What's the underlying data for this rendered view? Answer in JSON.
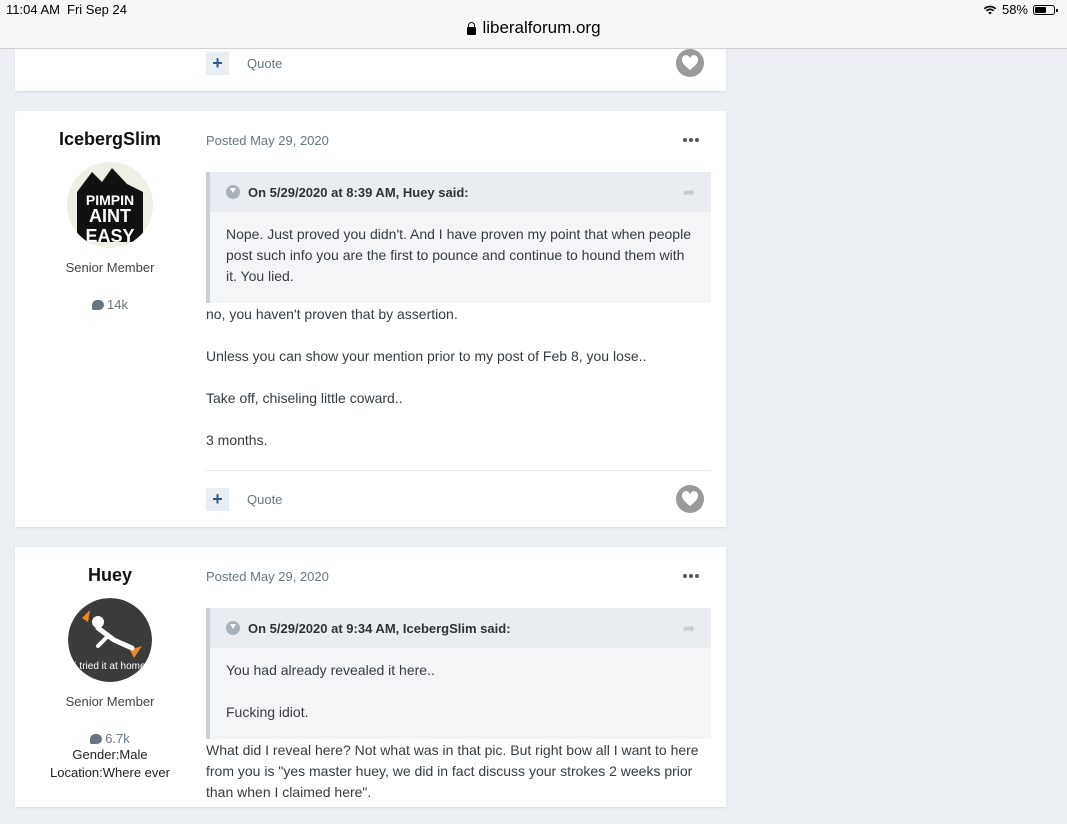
{
  "status": {
    "time": "11:04 AM",
    "date": "Fri Sep 24",
    "battery": "58%",
    "url": "liberalforum.org"
  },
  "actions": {
    "quote_label": "Quote",
    "plus": "+"
  },
  "posts": [
    {
      "author": "IcebergSlim",
      "rank": "Senior Member",
      "post_count": "14k",
      "posted": "Posted May 29, 2020",
      "avatar_text": [
        "PIMPIN",
        "AINT",
        "EASY"
      ],
      "quote": {
        "header": "On 5/29/2020 at 8:39 AM, Huey said:",
        "paragraphs": [
          "Nope.  Just proved you didn't.  And I have proven my point that when people post such info you are the first to pounce and continue to hound them with it.  You lied."
        ]
      },
      "body": [
        "no, you haven't proven that by assertion.",
        "Unless you can show your mention prior to my post of Feb 8, you lose..",
        "Take off, chiseling little coward..",
        "3 months."
      ]
    },
    {
      "author": "Huey",
      "rank": "Senior Member",
      "post_count": "6.7k",
      "gender": "Gender:Male",
      "location": "Location:Where ever",
      "posted": "Posted May 29, 2020",
      "avatar_text": "i tried it at home",
      "quote": {
        "header": "On 5/29/2020 at 9:34 AM, IcebergSlim said:",
        "paragraphs": [
          "You had already revealed it here..",
          "Fucking idiot."
        ]
      },
      "body": [
        "What did I reveal here?  Not what was in that pic.  But right bow all I want to here from you is \"yes master huey, we did in fact discuss your strokes 2 weeks prior than when I claimed here\"."
      ]
    }
  ]
}
